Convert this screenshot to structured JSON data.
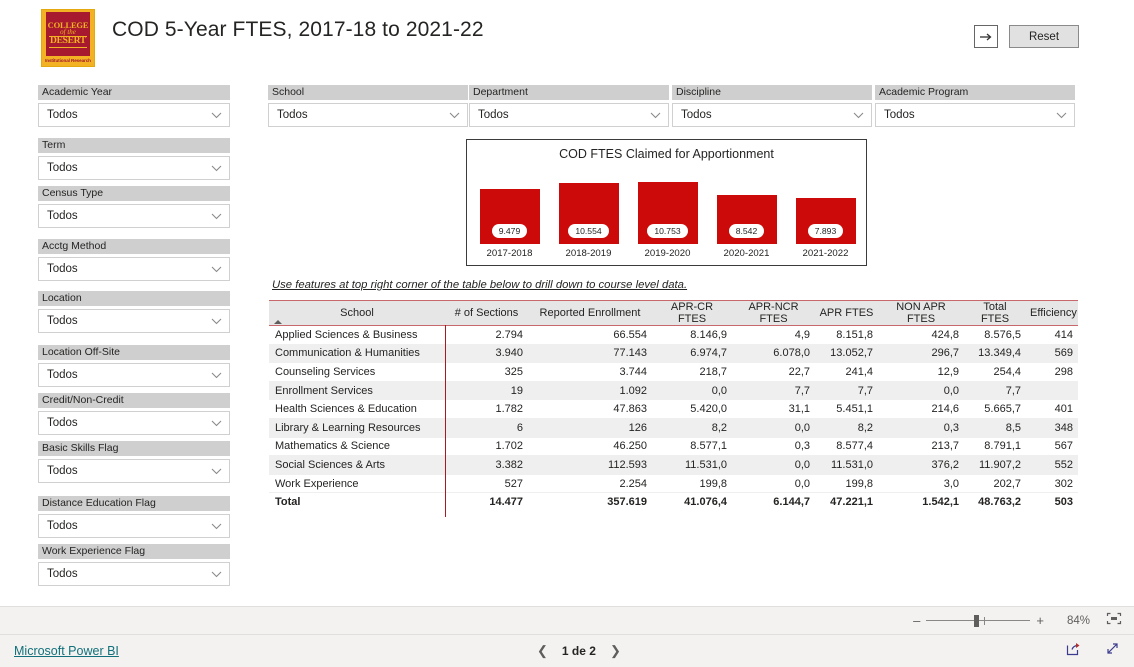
{
  "header": {
    "title": "COD 5-Year FTES, 2017-18 to 2021-22",
    "logo": {
      "line1": "COLLEGE",
      "line2": "of the",
      "line3": "DESERT",
      "caption": "Institutional Research",
      "border_color": "#F2B223",
      "field_color": "#A6192E"
    },
    "focus_icon": "arrow-right-box-icon",
    "reset_label": "Reset"
  },
  "left_slicers": [
    {
      "label": "Academic Year",
      "value": "Todos"
    },
    {
      "label": "Term",
      "value": "Todos"
    },
    {
      "label": "Census Type",
      "value": "Todos"
    },
    {
      "label": "Acctg Method",
      "value": "Todos"
    },
    {
      "label": "Location",
      "value": "Todos"
    },
    {
      "label": "Location Off-Site",
      "value": "Todos"
    },
    {
      "label": "Credit/Non-Credit",
      "value": "Todos"
    },
    {
      "label": "Basic Skills Flag",
      "value": "Todos"
    },
    {
      "label": "Distance Education Flag",
      "value": "Todos"
    },
    {
      "label": "Work Experience Flag",
      "value": "Todos"
    }
  ],
  "top_slicers": [
    {
      "label": "School",
      "value": "Todos"
    },
    {
      "label": "Department",
      "value": "Todos"
    },
    {
      "label": "Discipline",
      "value": "Todos"
    },
    {
      "label": "Academic Program",
      "value": "Todos"
    }
  ],
  "hint_text": "Use features at top right corner of the table below to drill down to course level data.",
  "chart_data": {
    "type": "bar",
    "title": "COD FTES Claimed for Apportionment",
    "categories": [
      "2017-2018",
      "2018-2019",
      "2019-2020",
      "2020-2021",
      "2021-2022"
    ],
    "values": [
      9479,
      10554,
      10753,
      8542,
      7893
    ],
    "value_labels": [
      "9.479",
      "10.554",
      "10.753",
      "8.542",
      "7.893"
    ],
    "bar_color": "#CC0A0A",
    "xlabel": "",
    "ylabel": "",
    "ylim": [
      0,
      11500
    ],
    "grid": false,
    "legend": "none"
  },
  "table": {
    "columns": [
      "School",
      "# of Sections",
      "Reported Enrollment",
      "APR-CR FTES",
      "APR-NCR FTES",
      "APR FTES",
      "NON APR FTES",
      "Total FTES",
      "Efficiency"
    ],
    "sort_column": "School",
    "sort_direction": "ascending",
    "rows": [
      {
        "school": "Applied Sciences & Business",
        "sections": "2.794",
        "enrollment": "66.554",
        "apr_cr": "8.146,9",
        "apr_ncr": "4,9",
        "apr": "8.151,8",
        "non_apr": "424,8",
        "total": "8.576,5",
        "efficiency": "414"
      },
      {
        "school": "Communication & Humanities",
        "sections": "3.940",
        "enrollment": "77.143",
        "apr_cr": "6.974,7",
        "apr_ncr": "6.078,0",
        "apr": "13.052,7",
        "non_apr": "296,7",
        "total": "13.349,4",
        "efficiency": "569"
      },
      {
        "school": "Counseling Services",
        "sections": "325",
        "enrollment": "3.744",
        "apr_cr": "218,7",
        "apr_ncr": "22,7",
        "apr": "241,4",
        "non_apr": "12,9",
        "total": "254,4",
        "efficiency": "298"
      },
      {
        "school": "Enrollment Services",
        "sections": "19",
        "enrollment": "1.092",
        "apr_cr": "0,0",
        "apr_ncr": "7,7",
        "apr": "7,7",
        "non_apr": "0,0",
        "total": "7,7",
        "efficiency": ""
      },
      {
        "school": "Health Sciences & Education",
        "sections": "1.782",
        "enrollment": "47.863",
        "apr_cr": "5.420,0",
        "apr_ncr": "31,1",
        "apr": "5.451,1",
        "non_apr": "214,6",
        "total": "5.665,7",
        "efficiency": "401"
      },
      {
        "school": "Library & Learning Resources",
        "sections": "6",
        "enrollment": "126",
        "apr_cr": "8,2",
        "apr_ncr": "0,0",
        "apr": "8,2",
        "non_apr": "0,3",
        "total": "8,5",
        "efficiency": "348"
      },
      {
        "school": "Mathematics & Science",
        "sections": "1.702",
        "enrollment": "46.250",
        "apr_cr": "8.577,1",
        "apr_ncr": "0,3",
        "apr": "8.577,4",
        "non_apr": "213,7",
        "total": "8.791,1",
        "efficiency": "567"
      },
      {
        "school": "Social Sciences & Arts",
        "sections": "3.382",
        "enrollment": "112.593",
        "apr_cr": "11.531,0",
        "apr_ncr": "0,0",
        "apr": "11.531,0",
        "non_apr": "376,2",
        "total": "11.907,2",
        "efficiency": "552"
      },
      {
        "school": "Work Experience",
        "sections": "527",
        "enrollment": "2.254",
        "apr_cr": "199,8",
        "apr_ncr": "0,0",
        "apr": "199,8",
        "non_apr": "3,0",
        "total": "202,7",
        "efficiency": "302"
      }
    ],
    "total_row": {
      "school": "Total",
      "sections": "14.477",
      "enrollment": "357.619",
      "apr_cr": "41.076,4",
      "apr_ncr": "6.144,7",
      "apr": "47.221,1",
      "non_apr": "1.542,1",
      "total": "48.763,2",
      "efficiency": "503"
    }
  },
  "zoom_bar": {
    "minus": "–",
    "plus": "+",
    "percent": "84%",
    "fit_icon": "fit-to-page-icon"
  },
  "footer": {
    "brand": "Microsoft Power BI",
    "prev_icon": "chevron-left-icon",
    "page_text": "1 de 2",
    "next_icon": "chevron-right-icon",
    "share_icon": "share-icon",
    "fullscreen_icon": "fullscreen-icon"
  }
}
